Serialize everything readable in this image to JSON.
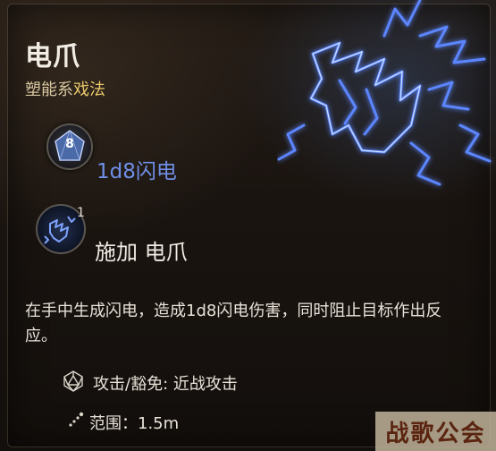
{
  "spell": {
    "name": "电爪",
    "school": "塑能系",
    "kind": "戏法"
  },
  "die": {
    "number": "8",
    "damage_text": "1d8闪电"
  },
  "action": {
    "count": "1",
    "label": "施加 电爪"
  },
  "description": "在手中生成闪电，造成1d8闪电伤害，同时阻止目标作出反应。",
  "properties": {
    "attack_save": "攻击/豁免: 近战攻击",
    "range": "范围：1.5m"
  },
  "watermark": "战歌公会",
  "colors": {
    "damage": "#6f8fe8",
    "kind": "#e9c96a",
    "lightning": "#4f7dff"
  },
  "icons": [
    "d8-die-icon",
    "lightning-hand-icon",
    "d20-icon",
    "range-dots-icon"
  ]
}
